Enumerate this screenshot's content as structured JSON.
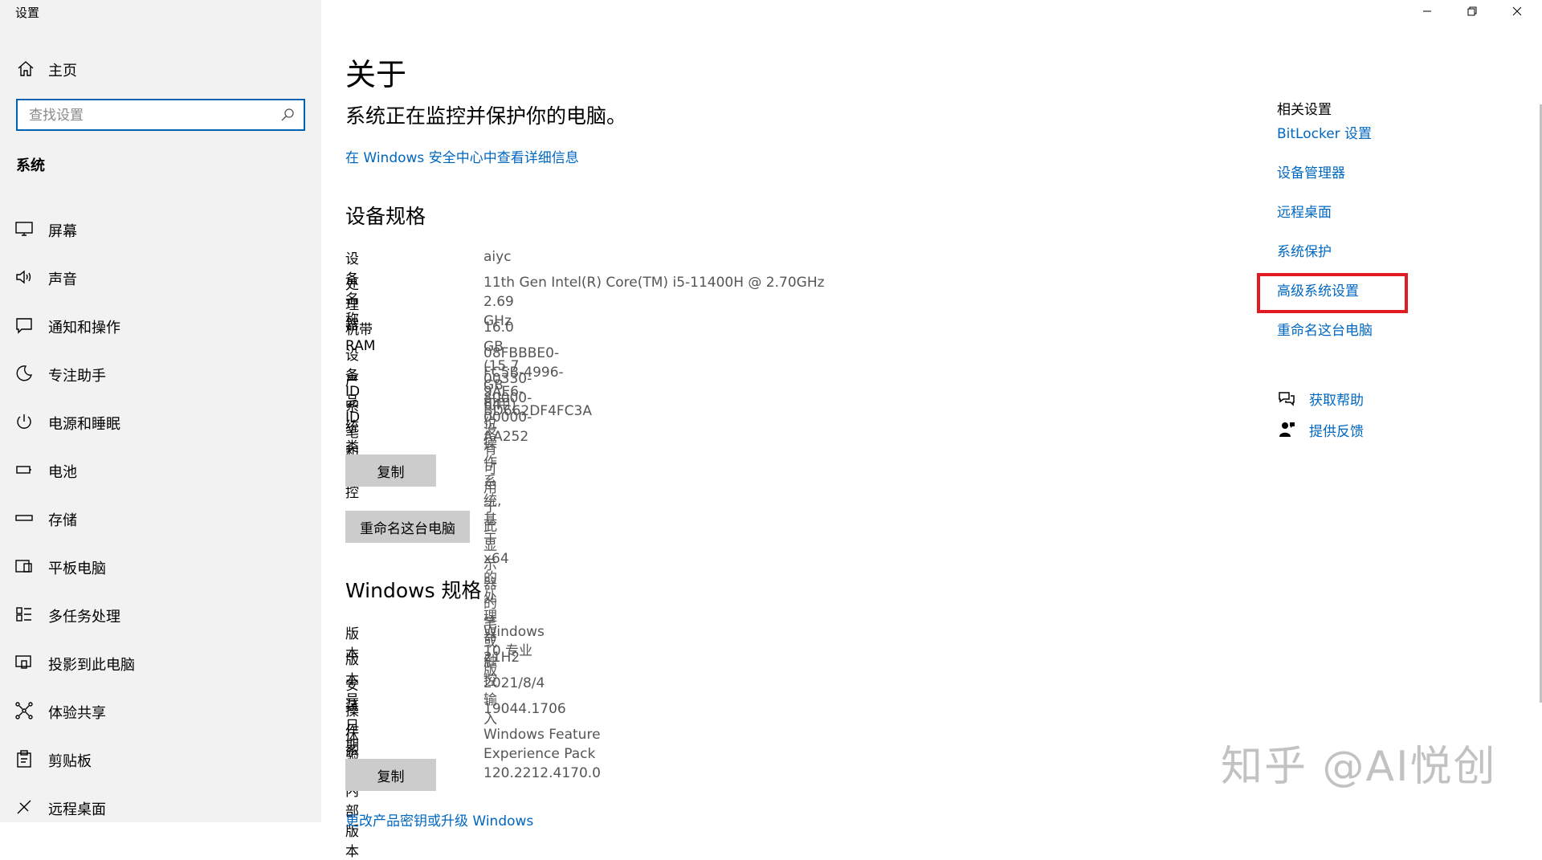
{
  "app": {
    "title": "设置"
  },
  "sidebar": {
    "home_label": "主页",
    "search_placeholder": "查找设置",
    "section_label": "系统",
    "items": [
      {
        "label": "屏幕",
        "icon": "monitor-icon"
      },
      {
        "label": "声音",
        "icon": "speaker-icon"
      },
      {
        "label": "通知和操作",
        "icon": "notification-icon"
      },
      {
        "label": "专注助手",
        "icon": "moon-icon"
      },
      {
        "label": "电源和睡眠",
        "icon": "power-icon"
      },
      {
        "label": "电池",
        "icon": "battery-icon"
      },
      {
        "label": "存储",
        "icon": "storage-icon"
      },
      {
        "label": "平板电脑",
        "icon": "tablet-icon"
      },
      {
        "label": "多任务处理",
        "icon": "multitask-icon"
      },
      {
        "label": "投影到此电脑",
        "icon": "project-icon"
      },
      {
        "label": "体验共享",
        "icon": "share-icon"
      },
      {
        "label": "剪贴板",
        "icon": "clipboard-icon"
      },
      {
        "label": "远程桌面",
        "icon": "remote-desktop-icon"
      }
    ]
  },
  "main": {
    "title": "关于",
    "protect_text": "系统正在监控并保护你的电脑。",
    "security_link": "在 Windows 安全中心中查看详细信息",
    "device_specs": {
      "heading": "设备规格",
      "rows": [
        {
          "key": "设备名称",
          "value": "aiyc"
        },
        {
          "key": "处理器",
          "value": "11th Gen Intel(R) Core(TM) i5-11400H @ 2.70GHz",
          "value2": "2.69 GHz"
        },
        {
          "key": "机带 RAM",
          "value": "16.0 GB (15.7 GB 可用)"
        },
        {
          "key": "设备 ID",
          "value": "08FBBBE0-FC5B-4996-9AE6-BD662DF4FC3A"
        },
        {
          "key": "产品 ID",
          "value": "00330-80000-00000-AA252"
        },
        {
          "key": "系统类型",
          "value": "64 位操作系统, 基于 x64 的处理器"
        },
        {
          "key": "笔和触控",
          "value": "没有可用于此显示器的笔或触控输入"
        }
      ],
      "copy_label": "复制",
      "rename_label": "重命名这台电脑"
    },
    "windows_specs": {
      "heading": "Windows 规格",
      "rows": [
        {
          "key": "版本",
          "value": "Windows 10 专业版"
        },
        {
          "key": "版本号",
          "value": "21H2"
        },
        {
          "key": "安装日期",
          "value": "2021/8/4"
        },
        {
          "key": "操作系统内部版本",
          "value": "19044.1706"
        },
        {
          "key": "体验",
          "value": "Windows Feature Experience Pack 120.2212.4170.0"
        }
      ],
      "copy_label": "复制"
    },
    "bottom_link": "更改产品密钥或升级 Windows"
  },
  "related": {
    "title": "相关设置",
    "links": [
      "BitLocker 设置",
      "设备管理器",
      "远程桌面",
      "系统保护",
      "高级系统设置",
      "重命名这台电脑"
    ],
    "highlighted_index": 4,
    "highlight_color": "#e01b24",
    "get_help": "获取帮助",
    "feedback": "提供反馈"
  },
  "watermark": "知乎 @AI悦创",
  "colors": {
    "accent": "#0067c0",
    "sidebar_bg": "#f2f2f2",
    "button_bg": "#cccccc"
  }
}
